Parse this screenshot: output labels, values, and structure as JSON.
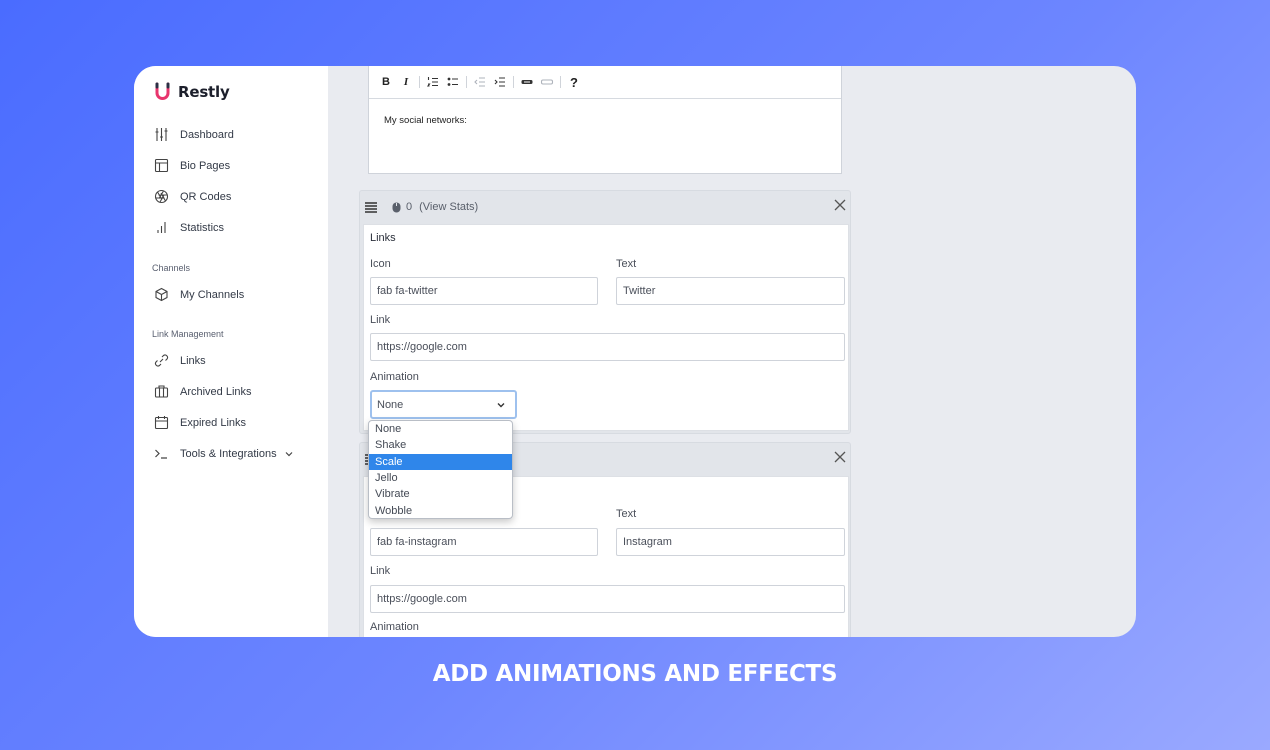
{
  "brand": {
    "name": "Restly",
    "logo_icon": "magnet-u-icon",
    "accent": "#e8356d"
  },
  "sidebar": {
    "items": [
      {
        "label": "Dashboard",
        "icon": "sliders-icon"
      },
      {
        "label": "Bio Pages",
        "icon": "layout-icon"
      },
      {
        "label": "QR Codes",
        "icon": "aperture-icon"
      },
      {
        "label": "Statistics",
        "icon": "bar-chart-icon"
      },
      {
        "label": "My Channels",
        "icon": "box-icon"
      },
      {
        "label": "Links",
        "icon": "link-icon"
      },
      {
        "label": "Archived Links",
        "icon": "archive-icon"
      },
      {
        "label": "Expired Links",
        "icon": "calendar-icon"
      },
      {
        "label": "Tools & Integrations",
        "icon": "terminal-icon"
      }
    ],
    "sections": {
      "channels": "Channels",
      "link_management": "Link Management"
    }
  },
  "editor": {
    "toolbar": {
      "bold": "B",
      "italic": "I",
      "help": "?"
    },
    "content": "My social networks:"
  },
  "block1": {
    "clicks": "0",
    "view_stats": "(View Stats)",
    "title": "Links",
    "icon_label": "Icon",
    "icon_value": "fab fa-twitter",
    "text_label": "Text",
    "text_value": "Twitter",
    "link_label": "Link",
    "link_value": "https://google.com",
    "animation_label": "Animation",
    "animation_value": "None"
  },
  "dropdown": {
    "options": [
      "None",
      "Shake",
      "Scale",
      "Jello",
      "Vibrate",
      "Wobble"
    ],
    "highlighted": "Scale"
  },
  "block2": {
    "text_label": "Text",
    "icon_value": "fab fa-instagram",
    "text_value": "Instagram",
    "link_label": "Link",
    "link_value": "https://google.com",
    "animation_label": "Animation"
  },
  "headline": "ADD ANIMATIONS AND EFFECTS",
  "colors": {
    "background_start": "#4a6cff",
    "background_end": "#9aa9ff",
    "highlight": "#2f86ea"
  }
}
